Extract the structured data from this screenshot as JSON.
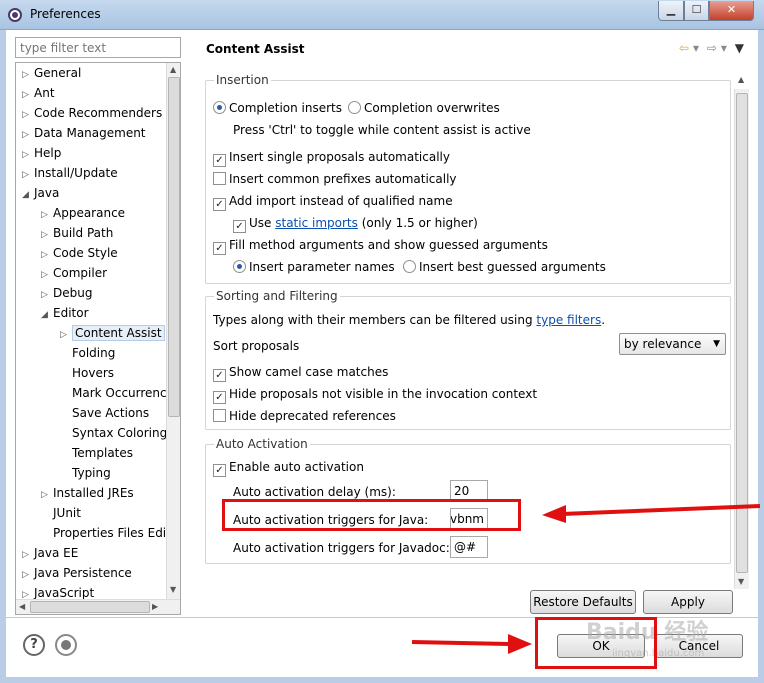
{
  "window": {
    "title": "Preferences"
  },
  "filter": {
    "placeholder": "type filter text"
  },
  "tree": {
    "items": [
      {
        "label": "General",
        "level": 0,
        "twisty": "collapsed"
      },
      {
        "label": "Ant",
        "level": 0,
        "twisty": "collapsed"
      },
      {
        "label": "Code Recommenders",
        "level": 0,
        "twisty": "collapsed"
      },
      {
        "label": "Data Management",
        "level": 0,
        "twisty": "collapsed"
      },
      {
        "label": "Help",
        "level": 0,
        "twisty": "collapsed"
      },
      {
        "label": "Install/Update",
        "level": 0,
        "twisty": "collapsed"
      },
      {
        "label": "Java",
        "level": 0,
        "twisty": "expanded"
      },
      {
        "label": "Appearance",
        "level": 1,
        "twisty": "collapsed"
      },
      {
        "label": "Build Path",
        "level": 1,
        "twisty": "collapsed"
      },
      {
        "label": "Code Style",
        "level": 1,
        "twisty": "collapsed"
      },
      {
        "label": "Compiler",
        "level": 1,
        "twisty": "collapsed"
      },
      {
        "label": "Debug",
        "level": 1,
        "twisty": "collapsed"
      },
      {
        "label": "Editor",
        "level": 1,
        "twisty": "expanded"
      },
      {
        "label": "Content Assist",
        "level": 2,
        "twisty": "collapsed",
        "selected": true
      },
      {
        "label": "Folding",
        "level": 2,
        "twisty": "none"
      },
      {
        "label": "Hovers",
        "level": 2,
        "twisty": "none"
      },
      {
        "label": "Mark Occurrences",
        "level": 2,
        "twisty": "none"
      },
      {
        "label": "Save Actions",
        "level": 2,
        "twisty": "none"
      },
      {
        "label": "Syntax Coloring",
        "level": 2,
        "twisty": "none"
      },
      {
        "label": "Templates",
        "level": 2,
        "twisty": "none"
      },
      {
        "label": "Typing",
        "level": 2,
        "twisty": "none"
      },
      {
        "label": "Installed JREs",
        "level": 1,
        "twisty": "collapsed"
      },
      {
        "label": "JUnit",
        "level": 1,
        "twisty": "none"
      },
      {
        "label": "Properties Files Editor",
        "level": 1,
        "twisty": "none"
      },
      {
        "label": "Java EE",
        "level": 0,
        "twisty": "collapsed"
      },
      {
        "label": "Java Persistence",
        "level": 0,
        "twisty": "collapsed"
      },
      {
        "label": "JavaScript",
        "level": 0,
        "twisty": "collapsed"
      }
    ]
  },
  "page": {
    "title": "Content Assist",
    "nav_icons": {
      "back": "back-arrow-icon",
      "forward": "forward-arrow-icon",
      "menu": "view-menu-icon"
    }
  },
  "insertion": {
    "title": "Insertion",
    "completion_inserts": "Completion inserts",
    "completion_overwrites": "Completion overwrites",
    "toggle_hint": "Press 'Ctrl' to toggle while content assist is active",
    "insert_single": "Insert single proposals automatically",
    "insert_common": "Insert common prefixes automatically",
    "add_import": "Add import instead of qualified name",
    "use_prefix": "Use",
    "static_imports": "static imports",
    "use_suffix": "(only 1.5 or higher)",
    "fill_method": "Fill method arguments and show guessed arguments",
    "insert_param_names": "Insert parameter names",
    "insert_best_guessed": "Insert best guessed arguments",
    "checked": {
      "insert_single": true,
      "insert_common": false,
      "add_import": true,
      "use_static": true,
      "fill_method": true
    }
  },
  "sorting": {
    "title": "Sorting and Filtering",
    "filter_prefix": "Types along with their members can be filtered using",
    "type_filters": "type filters",
    "filter_suffix": ".",
    "sort_label": "Sort proposals",
    "sort_value": "by relevance",
    "camel_case": "Show camel case matches",
    "hide_not_visible": "Hide proposals not visible in the invocation context",
    "hide_deprecated": "Hide deprecated references",
    "checked": {
      "camel_case": true,
      "hide_not_visible": true,
      "hide_deprecated": false
    }
  },
  "auto_activation": {
    "title": "Auto Activation",
    "enable": "Enable auto activation",
    "enable_checked": true,
    "delay_label": "Auto activation delay (ms):",
    "delay_value": "20",
    "java_label": "Auto activation triggers for Java:",
    "java_value": "vbnm",
    "javadoc_label": "Auto activation triggers for Javadoc:",
    "javadoc_value": "@#"
  },
  "buttons": {
    "restore_defaults": "Restore Defaults",
    "apply": "Apply",
    "ok": "OK",
    "cancel": "Cancel"
  },
  "watermark": {
    "text": "Baidu 经验",
    "sub": "jingyan.baidu.com"
  },
  "colors": {
    "highlight": "#e01010",
    "link": "#0a4fb0",
    "selection": "#e6eef8"
  }
}
